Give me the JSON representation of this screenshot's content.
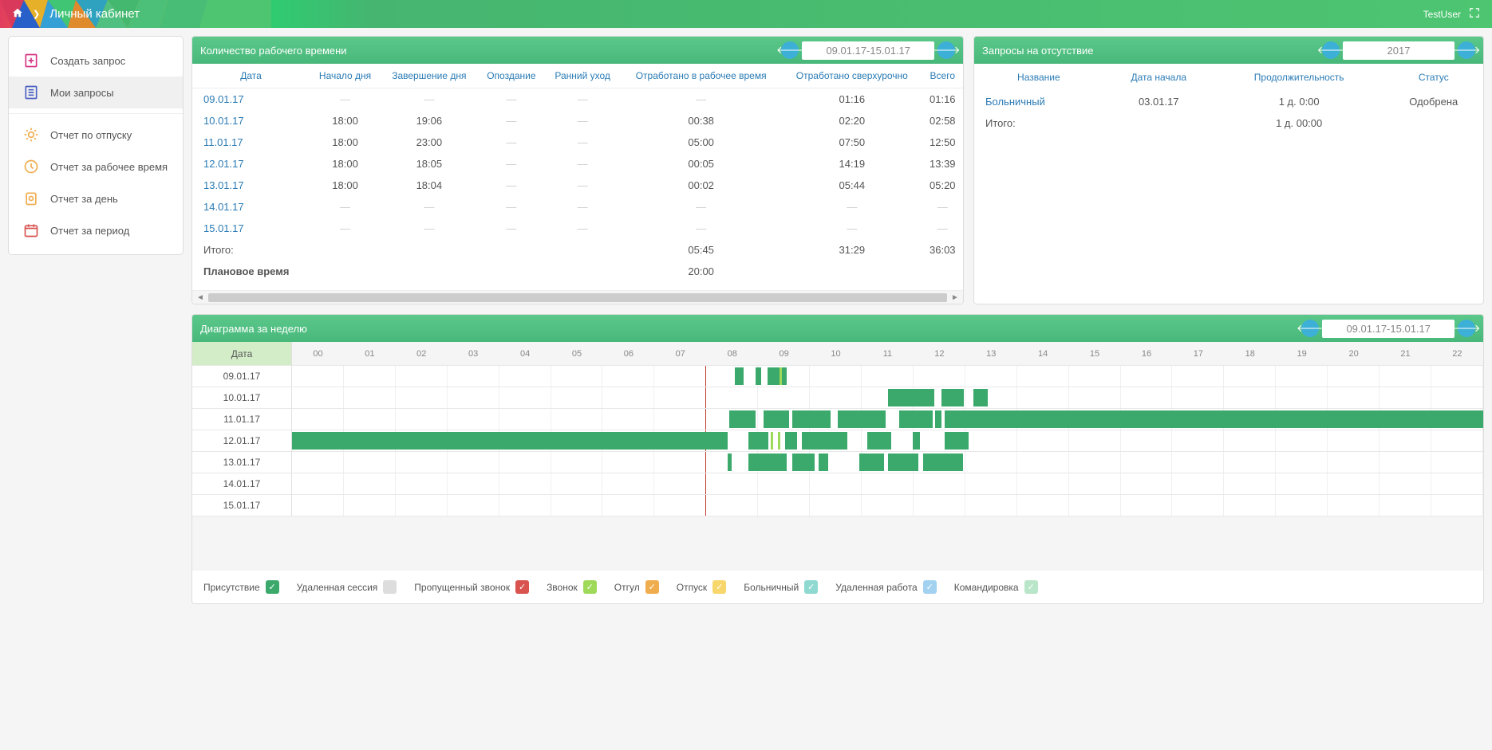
{
  "header": {
    "title": "Личный кабинет",
    "user": "TestUser"
  },
  "sidebar": {
    "items": [
      {
        "label": "Создать запрос"
      },
      {
        "label": "Мои запросы"
      },
      {
        "label": "Отчет по отпуску"
      },
      {
        "label": "Отчет за рабочее время"
      },
      {
        "label": "Отчет за день"
      },
      {
        "label": "Отчет за период"
      }
    ]
  },
  "worktime_panel": {
    "title": "Количество рабочего времени",
    "date_range": "09.01.17-15.01.17",
    "headers": [
      "Дата",
      "Начало дня",
      "Завершение дня",
      "Опоздание",
      "Ранний уход",
      "Отработано в рабочее время",
      "Отработано сверхурочно",
      "Всего"
    ],
    "rows": [
      {
        "date": "09.01.17",
        "start": "—",
        "end": "—",
        "late": "—",
        "early": "—",
        "worked": "—",
        "over": "01:16",
        "total": "01:16"
      },
      {
        "date": "10.01.17",
        "start": "18:00",
        "end": "19:06",
        "late": "—",
        "early": "—",
        "worked": "00:38",
        "over": "02:20",
        "total": "02:58"
      },
      {
        "date": "11.01.17",
        "start": "18:00",
        "end": "23:00",
        "late": "—",
        "early": "—",
        "worked": "05:00",
        "over": "07:50",
        "total": "12:50"
      },
      {
        "date": "12.01.17",
        "start": "18:00",
        "end": "18:05",
        "late": "—",
        "early": "—",
        "worked": "00:05",
        "over": "14:19",
        "total": "13:39"
      },
      {
        "date": "13.01.17",
        "start": "18:00",
        "end": "18:04",
        "late": "—",
        "early": "—",
        "worked": "00:02",
        "over": "05:44",
        "total": "05:20"
      },
      {
        "date": "14.01.17",
        "start": "—",
        "end": "—",
        "late": "—",
        "early": "—",
        "worked": "—",
        "over": "—",
        "total": "—"
      },
      {
        "date": "15.01.17",
        "start": "—",
        "end": "—",
        "late": "—",
        "early": "—",
        "worked": "—",
        "over": "—",
        "total": "—"
      }
    ],
    "total_row": {
      "label": "Итого:",
      "worked": "05:45",
      "over": "31:29",
      "total": "36:03"
    },
    "plan_row": {
      "label": "Плановое время",
      "worked": "20:00"
    }
  },
  "absence_panel": {
    "title": "Запросы на отсутствие",
    "year": "2017",
    "headers": [
      "Название",
      "Дата начала",
      "Продолжительность",
      "Статус"
    ],
    "rows": [
      {
        "name": "Больничный",
        "start": "03.01.17",
        "duration": "1 д. 0:00",
        "status": "Одобрена"
      }
    ],
    "total": {
      "label": "Итого:",
      "duration": "1 д. 00:00"
    }
  },
  "diagram_panel": {
    "title": "Диаграмма за неделю",
    "date_range": "09.01.17-15.01.17",
    "date_header": "Дата",
    "hours": [
      "00",
      "01",
      "02",
      "03",
      "04",
      "05",
      "06",
      "07",
      "08",
      "09",
      "10",
      "11",
      "12",
      "13",
      "14",
      "15",
      "16",
      "17",
      "18",
      "19",
      "20",
      "21",
      "22"
    ],
    "days": [
      "09.01.17",
      "10.01.17",
      "11.01.17",
      "12.01.17",
      "13.01.17",
      "14.01.17",
      "15.01.17"
    ],
    "bars": {
      "09.01.17": [
        [
          37.2,
          37.9
        ],
        [
          38.9,
          39.4
        ],
        [
          39.9,
          41.5
        ]
      ],
      "10.01.17": [
        [
          50.0,
          53.9
        ],
        [
          54.5,
          56.4
        ],
        [
          57.2,
          58.4
        ]
      ],
      "11.01.17": [
        [
          36.7,
          38.9
        ],
        [
          39.6,
          41.7
        ],
        [
          42.0,
          45.2
        ],
        [
          45.8,
          49.8
        ],
        [
          51.0,
          53.8
        ],
        [
          54.0,
          54.5
        ],
        [
          54.8,
          100.0
        ]
      ],
      "12.01.17": [
        [
          0,
          36.6
        ],
        [
          38.3,
          40.0
        ],
        [
          41.4,
          42.4
        ],
        [
          42.8,
          46.6
        ],
        [
          48.3,
          50.3
        ],
        [
          52.1,
          52.7
        ],
        [
          54.8,
          56.8
        ]
      ],
      "13.01.17": [
        [
          36.6,
          36.9
        ],
        [
          38.3,
          41.5
        ],
        [
          42.0,
          43.9
        ],
        [
          44.2,
          45.0
        ],
        [
          47.6,
          49.7
        ],
        [
          50.0,
          52.6
        ],
        [
          53.0,
          56.3
        ]
      ],
      "14.01.17": [],
      "15.01.17": []
    },
    "accents": {
      "09.01.17": [
        40.9
      ],
      "12.01.17": [
        40.2,
        40.8
      ]
    }
  },
  "legend": [
    {
      "label": "Присутствие",
      "color": "green",
      "checked": true
    },
    {
      "label": "Удаленная сессия",
      "color": "grey",
      "checked": false
    },
    {
      "label": "Пропущенный звонок",
      "color": "red",
      "checked": true
    },
    {
      "label": "Звонок",
      "color": "lgreen",
      "checked": true
    },
    {
      "label": "Отгул",
      "color": "orange",
      "checked": true
    },
    {
      "label": "Отпуск",
      "color": "yellow",
      "checked": true
    },
    {
      "label": "Больничный",
      "color": "teal",
      "checked": true
    },
    {
      "label": "Удаленная работа",
      "color": "lblue",
      "checked": true
    },
    {
      "label": "Командировка",
      "color": "pgreen",
      "checked": true
    }
  ]
}
